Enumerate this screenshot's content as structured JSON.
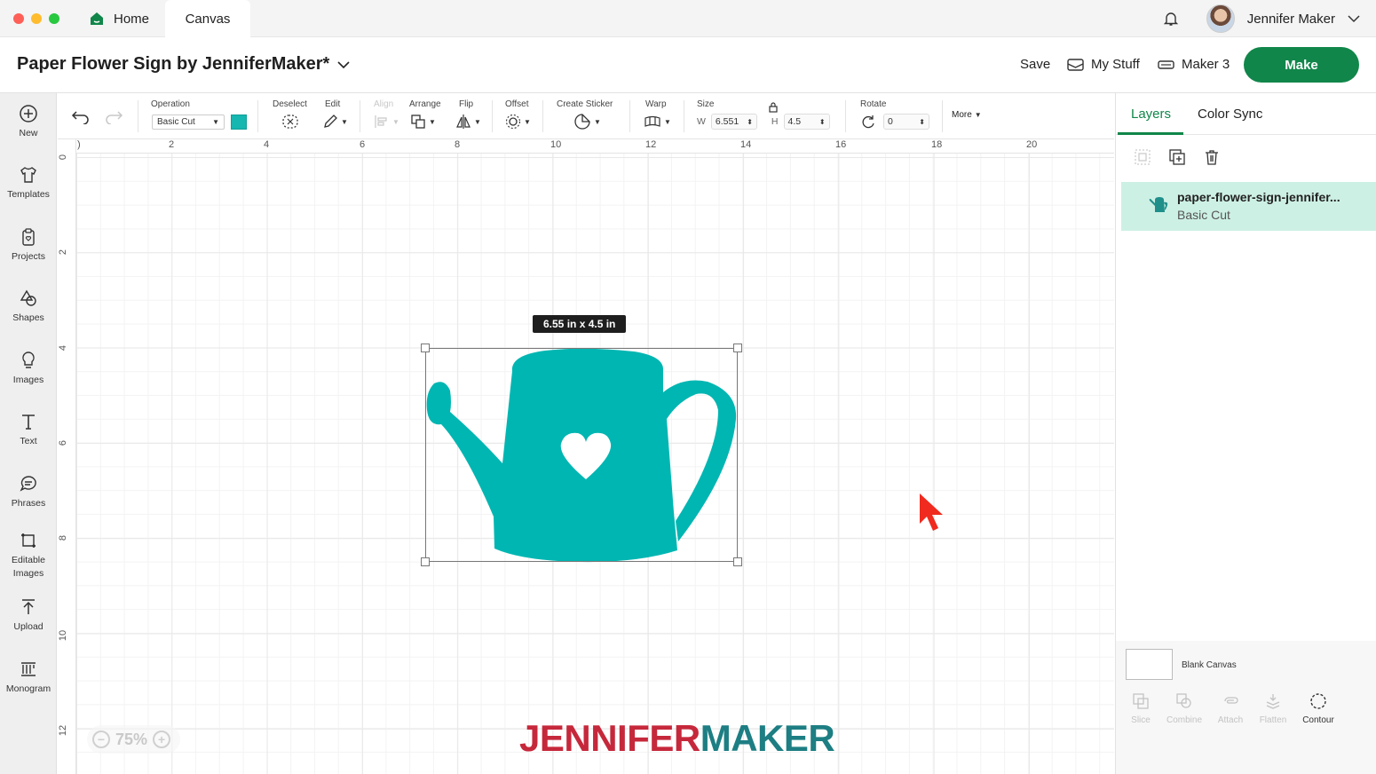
{
  "window": {
    "tabs": [
      {
        "label": "Home"
      },
      {
        "label": "Canvas"
      }
    ],
    "user_name": "Jennifer Maker"
  },
  "header": {
    "project_title": "Paper Flower Sign by JenniferMaker*",
    "save_label": "Save",
    "my_stuff_label": "My Stuff",
    "machine_label": "Maker 3",
    "make_label": "Make"
  },
  "sidebar": {
    "items": [
      {
        "label": "New",
        "icon": "plus-circle-icon"
      },
      {
        "label": "Templates",
        "icon": "tshirt-icon"
      },
      {
        "label": "Projects",
        "icon": "clipboard-icon"
      },
      {
        "label": "Shapes",
        "icon": "shapes-icon"
      },
      {
        "label": "Images",
        "icon": "lightbulb-icon"
      },
      {
        "label": "Text",
        "icon": "text-icon"
      },
      {
        "label": "Phrases",
        "icon": "speech-bubble-icon"
      },
      {
        "label": "Editable Images",
        "icon": "editable-image-icon"
      },
      {
        "label": "Upload",
        "icon": "upload-icon"
      },
      {
        "label": "Monogram",
        "icon": "monogram-icon"
      }
    ]
  },
  "toolbar": {
    "operation_label": "Operation",
    "operation_value": "Basic Cut",
    "operation_color": "#15b7b0",
    "deselect_label": "Deselect",
    "edit_label": "Edit",
    "align_label": "Align",
    "arrange_label": "Arrange",
    "flip_label": "Flip",
    "offset_label": "Offset",
    "create_sticker_label": "Create Sticker",
    "warp_label": "Warp",
    "size_label": "Size",
    "width_prefix": "W",
    "width_value": "6.551",
    "height_prefix": "H",
    "height_value": "4.5",
    "rotate_label": "Rotate",
    "rotate_value": "0",
    "more_label": "More"
  },
  "canvas": {
    "ruler_x": [
      "2",
      "4",
      "6",
      "8",
      "10",
      "12",
      "14",
      "16",
      "18",
      "20"
    ],
    "ruler_y": [
      "0",
      "2",
      "4",
      "6",
      "8",
      "10",
      "12"
    ],
    "dimension_tooltip": "6.55  in x 4.5  in",
    "zoom_value": "75%",
    "shape_color": "#00b6b2",
    "logo_part1": "JENNIFER",
    "logo_part2": "MAKER",
    "logo_color1": "#c6283b",
    "logo_color2": "#1d7e83"
  },
  "layers_panel": {
    "tabs": [
      {
        "label": "Layers"
      },
      {
        "label": "Color Sync"
      }
    ],
    "layer": {
      "name": "paper-flower-sign-jennifer...",
      "operation": "Basic Cut"
    },
    "blank_canvas_label": "Blank Canvas",
    "bottom_tools": [
      {
        "label": "Slice",
        "icon": "slice-icon",
        "enabled": false
      },
      {
        "label": "Combine",
        "icon": "combine-icon",
        "enabled": false
      },
      {
        "label": "Attach",
        "icon": "attach-icon",
        "enabled": false
      },
      {
        "label": "Flatten",
        "icon": "flatten-icon",
        "enabled": false
      },
      {
        "label": "Contour",
        "icon": "contour-icon",
        "enabled": true
      }
    ]
  },
  "colors": {
    "accent": "#11864a",
    "layer_highlight": "#cdf0e5",
    "cursor": "#f02a1e"
  }
}
